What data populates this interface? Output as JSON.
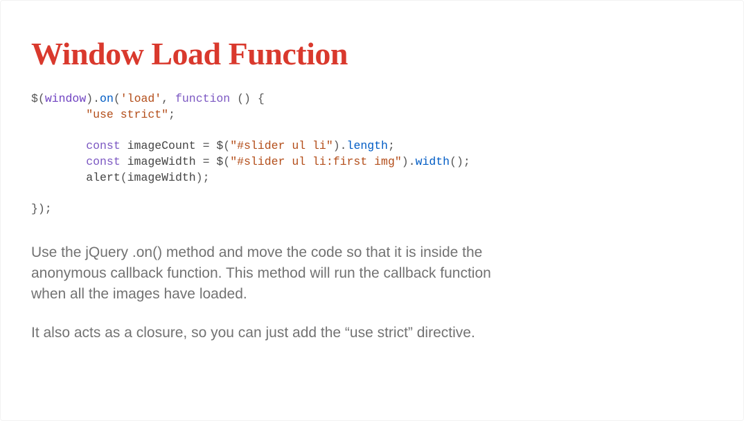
{
  "title": "Window Load Function",
  "code": {
    "line1": {
      "p1": "$(",
      "window": "window",
      "p2": ").",
      "on": "on",
      "p3": "(",
      "q1": "'load'",
      "p4": ", ",
      "fn": "function",
      "p5": " () {"
    },
    "line2": {
      "indent": "        ",
      "str": "\"use strict\"",
      "p1": ";"
    },
    "blank1": " ",
    "line3": {
      "indent": "        ",
      "const": "const",
      "sp1": " ",
      "name": "imageCount",
      "eq": " = ",
      "dollar": "$",
      "p1": "(",
      "sel": "\"#slider ul li\"",
      "p2": ").",
      "prop": "length",
      "p3": ";"
    },
    "line4": {
      "indent": "        ",
      "const": "const",
      "sp1": " ",
      "name": "imageWidth",
      "eq": " = ",
      "dollar": "$",
      "p1": "(",
      "sel": "\"#slider ul li:first img\"",
      "p2": ").",
      "method": "width",
      "p3": "();"
    },
    "line5": {
      "indent": "        ",
      "alert": "alert",
      "p1": "(",
      "arg": "imageWidth",
      "p2": ");"
    },
    "blank2": " ",
    "line6": {
      "p1": "});"
    }
  },
  "paragraph1": "Use the jQuery .on() method and move the code so that it is inside the anonymous callback function. This method will run the callback function when all the images have loaded.",
  "paragraph2": "It also acts as a closure, so you can just add the “use strict” directive."
}
